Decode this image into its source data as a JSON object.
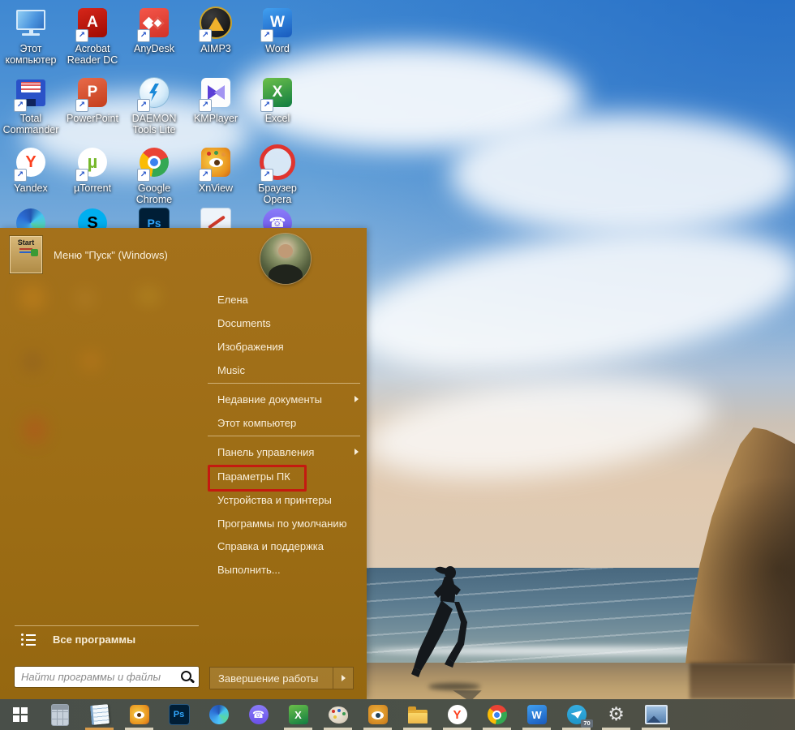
{
  "desktop": {
    "icons": [
      {
        "label": "Этот компьютер"
      },
      {
        "label": "Acrobat Reader DC"
      },
      {
        "label": "AnyDesk"
      },
      {
        "label": "AIMP3"
      },
      {
        "label": "Word"
      },
      {
        "label": "Total Commander"
      },
      {
        "label": "PowerPoint"
      },
      {
        "label": "DAEMON Tools Lite"
      },
      {
        "label": "KMPlayer"
      },
      {
        "label": "Excel"
      },
      {
        "label": "Yandex"
      },
      {
        "label": "µTorrent"
      },
      {
        "label": "Google Chrome"
      },
      {
        "label": "XnView"
      },
      {
        "label": "Браузер Opera"
      }
    ]
  },
  "icon_letters": {
    "acrobat": "A",
    "word": "W",
    "powerpoint": "P",
    "excel": "X",
    "yandex": "Y",
    "utorrent": "µ",
    "skype": "S",
    "photoshop": "Ps",
    "viber": "☎",
    "settings_gear": "⚙"
  },
  "start_menu": {
    "pinned_tile_text": "Start",
    "pinned_item_label": "Меню \"Пуск\" (Windows)",
    "items": [
      {
        "label": "Елена"
      },
      {
        "label": "Documents"
      },
      {
        "label": "Изображения"
      },
      {
        "label": "Music"
      },
      {
        "label": "Недавние документы",
        "submenu": true
      },
      {
        "label": "Этот компьютер"
      },
      {
        "label": "Панель управления",
        "submenu": true
      },
      {
        "label": "Параметры ПК",
        "highlighted": true
      },
      {
        "label": "Устройства и принтеры"
      },
      {
        "label": "Программы по умолчанию"
      },
      {
        "label": "Справка и поддержка"
      },
      {
        "label": "Выполнить..."
      }
    ],
    "all_programs_label": "Все программы",
    "search_placeholder": "Найти программы и файлы",
    "shutdown_label": "Завершение работы",
    "annotation_color": "#c41a10"
  },
  "taskbar": {
    "telegram_badge": "70"
  }
}
